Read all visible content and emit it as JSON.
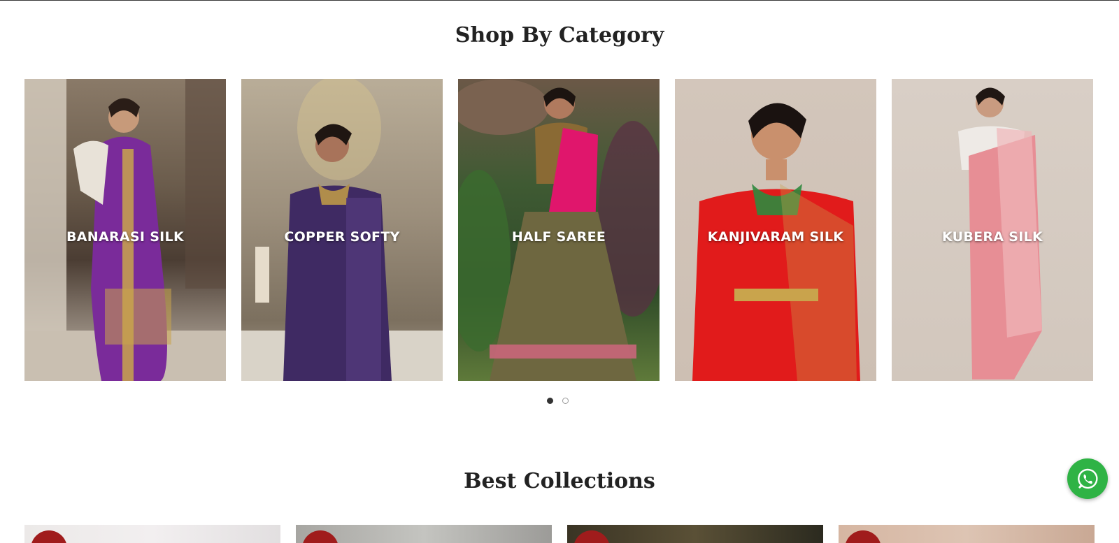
{
  "sections": {
    "shop_by_category": "Shop By Category",
    "best_collections": "Best Collections"
  },
  "categories": [
    {
      "label": "BANARASI SILK",
      "saree_color": "#7a2b9a",
      "border_color": "#c9a44c"
    },
    {
      "label": "COPPER SOFTY",
      "saree_color": "#3f2a63",
      "border_color": "#b08d4b"
    },
    {
      "label": "HALF SAREE",
      "saree_color": "#e0166c",
      "border_color": "#8d7a45"
    },
    {
      "label": "KANJIVARAM SILK",
      "saree_color": "#e11b1b",
      "border_color": "#c9a44c"
    },
    {
      "label": "KUBERA SILK",
      "saree_color": "#e78e95",
      "border_color": "#f0b6b9"
    }
  ],
  "carousel": {
    "pages": 2,
    "active_page": 1
  },
  "whatsapp": {
    "icon": "whatsapp-icon",
    "color": "#2fb345"
  },
  "collections": [
    {
      "badge_color": "#a01c1c"
    },
    {
      "badge_color": "#a01c1c"
    },
    {
      "badge_color": "#a01c1c"
    },
    {
      "badge_color": "#a01c1c"
    }
  ]
}
